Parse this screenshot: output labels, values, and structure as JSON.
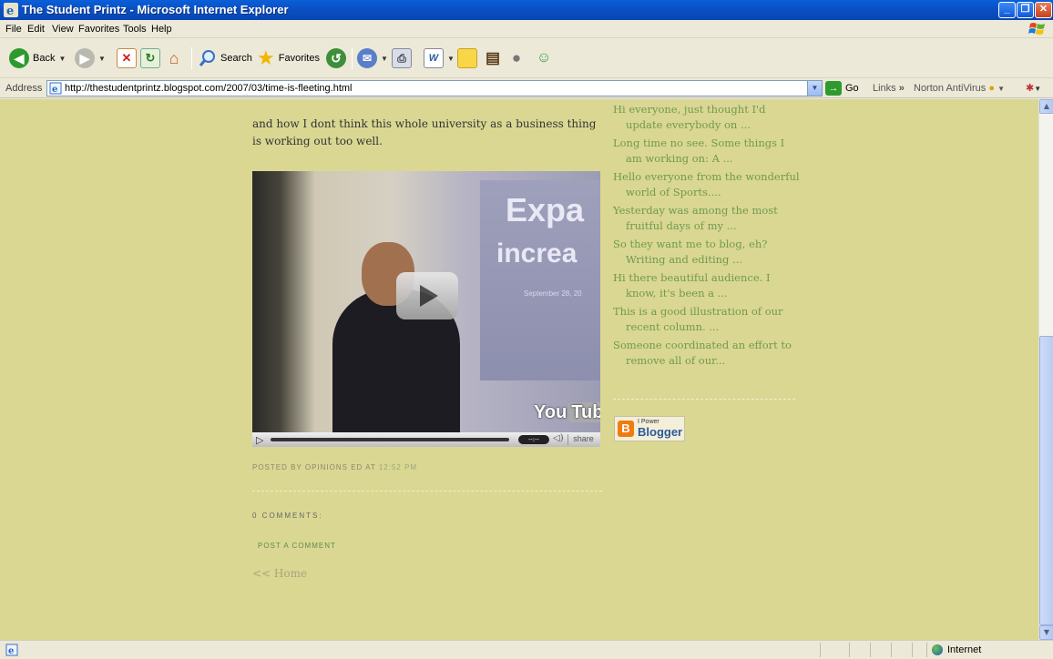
{
  "window": {
    "title": "The Student Printz - Microsoft Internet Explorer"
  },
  "menu": [
    "File",
    "Edit",
    "View",
    "Favorites",
    "Tools",
    "Help"
  ],
  "toolbar": {
    "back_label": "Back",
    "search_label": "Search",
    "favorites_label": "Favorites"
  },
  "address": {
    "label": "Address",
    "url": "http://thestudentprintz.blogspot.com/2007/03/time-is-fleeting.html",
    "go_label": "Go",
    "links_label": "Links",
    "norton_label": "Norton AntiVirus"
  },
  "post": {
    "text": "and how I dont think this whole university as a business thing is working out too well.",
    "posted_by": "POSTED BY OPINIONS ED AT",
    "posted_time": "12:52 PM",
    "comments_header": "0 COMMENTS:",
    "post_comment": "POST A COMMENT",
    "home_link": "<< Home"
  },
  "video": {
    "slide_word1": "Expa",
    "slide_word2": "increa",
    "slide_date": "September 28, 20",
    "brand_you": "You",
    "brand_tube": "Tube",
    "time_display": "--:--",
    "share_label": "share"
  },
  "sidebar": {
    "recent": [
      "Hi everyone, just thought I'd update everybody on ...",
      "Long time no see. Some things I am working on: A ...",
      "Hello everyone from the wonderful world of Sports....",
      "Yesterday was among the most fruitful days of my ...",
      "So they want me to blog, eh? Writing and editing ...",
      "Hi there beautiful audience. I know, it's been a ...",
      "This is a good illustration of our recent column. ...",
      "Someone coordinated an effort to remove all of our..."
    ],
    "badge_power": "I Power",
    "badge_word": "Blogger"
  },
  "status": {
    "zone": "Internet"
  },
  "colors": {
    "page_bg": "#dad793",
    "link_green": "#6f9a4d",
    "xp_blue": "#0a52c6"
  }
}
